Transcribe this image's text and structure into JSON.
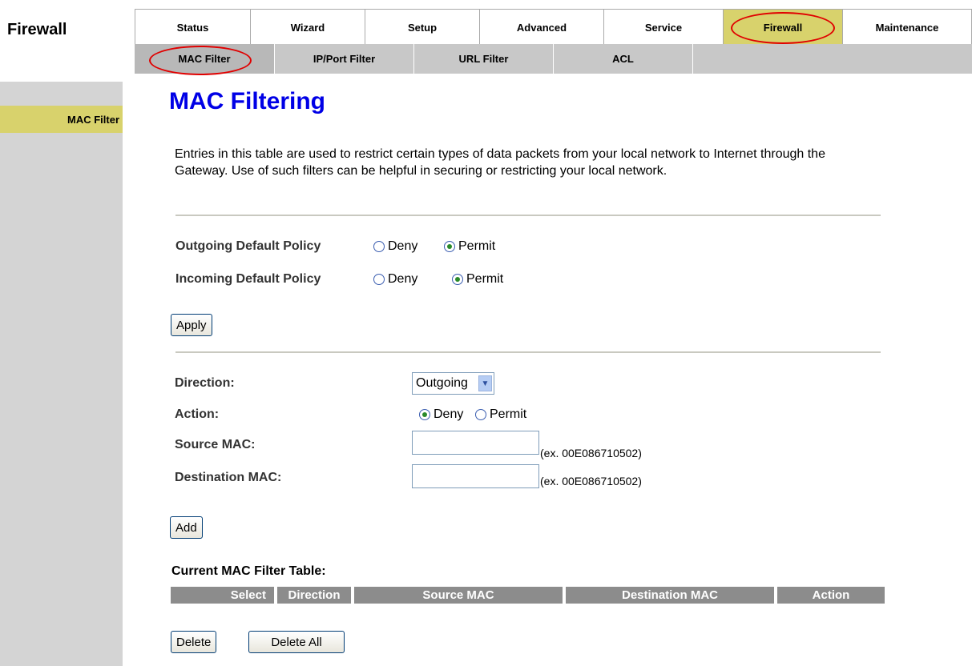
{
  "section_title": "Firewall",
  "main_tabs": [
    {
      "label": "Status"
    },
    {
      "label": "Wizard"
    },
    {
      "label": "Setup"
    },
    {
      "label": "Advanced"
    },
    {
      "label": "Service"
    },
    {
      "label": "Firewall"
    },
    {
      "label": "Maintenance"
    }
  ],
  "sub_tabs": [
    {
      "label": "MAC Filter"
    },
    {
      "label": "IP/Port Filter"
    },
    {
      "label": "URL Filter"
    },
    {
      "label": "ACL"
    }
  ],
  "sidebar": {
    "items": [
      {
        "label": "MAC Filter"
      }
    ]
  },
  "page": {
    "title": "MAC Filtering",
    "description": "Entries in this table are used to restrict certain types of data packets from your local network to Internet through the Gateway. Use of such filters can be helpful in securing or restricting your local network."
  },
  "policy": {
    "outgoing_label": "Outgoing Default Policy",
    "incoming_label": "Incoming Default Policy",
    "deny_label": "Deny",
    "permit_label": "Permit",
    "outgoing_value": "Permit",
    "incoming_value": "Permit",
    "apply_label": "Apply"
  },
  "rule_form": {
    "direction_label": "Direction:",
    "direction_value": "Outgoing",
    "action_label": "Action:",
    "action_deny": "Deny",
    "action_permit": "Permit",
    "action_value": "Deny",
    "source_mac_label": "Source MAC:",
    "source_mac_value": "",
    "source_mac_hint": "(ex. 00E086710502)",
    "dest_mac_label": "Destination MAC:",
    "dest_mac_value": "",
    "dest_mac_hint": "(ex. 00E086710502)",
    "add_label": "Add"
  },
  "filter_table": {
    "title": "Current MAC Filter Table:",
    "columns": [
      "Select",
      "Direction",
      "Source MAC",
      "Destination MAC",
      "Action"
    ],
    "rows": []
  },
  "actions": {
    "delete_label": "Delete",
    "delete_all_label": "Delete All"
  },
  "colors": {
    "active_tab": "#d8d26c",
    "title_blue": "#0000e6",
    "table_header": "#8c8c8c",
    "annotation_red": "#e00000",
    "left_panel": "#d4d4d4"
  }
}
